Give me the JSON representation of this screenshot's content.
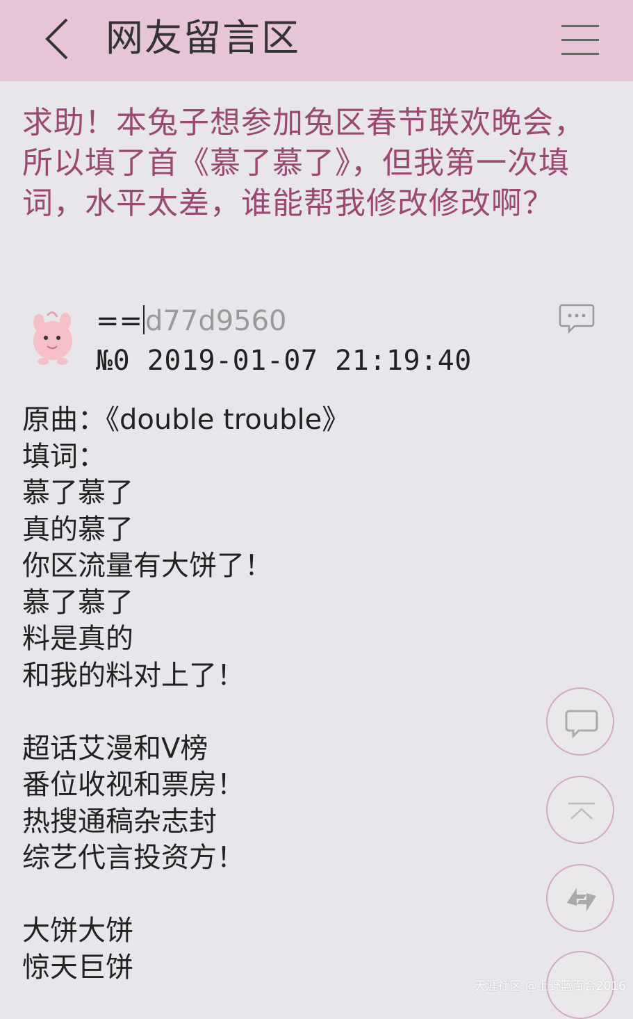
{
  "header": {
    "title": "网友留言区",
    "back_icon": "chevron-left-icon",
    "menu_icon": "hamburger-menu-icon"
  },
  "question": "求助！本兔子想参加兔区春节联欢晚会，所以填了首《慕了慕了》，但我第一次填词，水平太差，谁能帮我修改修改啊？",
  "post": {
    "username_prefix": "==",
    "username_id": "d77d9560",
    "meta": "№0 2019-01-07 21:19:40",
    "reply_icon": "comment-icon",
    "lines": [
      "原曲：《double trouble》",
      "填词：",
      "慕了慕了",
      "真的慕了",
      "你区流量有大饼了！",
      "慕了慕了",
      "料是真的",
      "和我的料对上了！",
      "",
      "超话艾漫和V榜",
      "番位收视和票房！",
      "热搜通稿杂志封",
      "综艺代言投资方！",
      "",
      "大饼大饼",
      "惊天巨饼"
    ]
  },
  "fabs": {
    "comment": "comment-bubble-icon",
    "top": "scroll-to-top-icon",
    "refresh": "refresh-icon"
  },
  "watermark": "天涯社区 @上野蓝百合2016",
  "colors": {
    "header_bg": "#e7c5d9",
    "page_bg": "#e8e6ea",
    "question_text": "#9a4a72",
    "fab_border": "#d2a9bf"
  }
}
